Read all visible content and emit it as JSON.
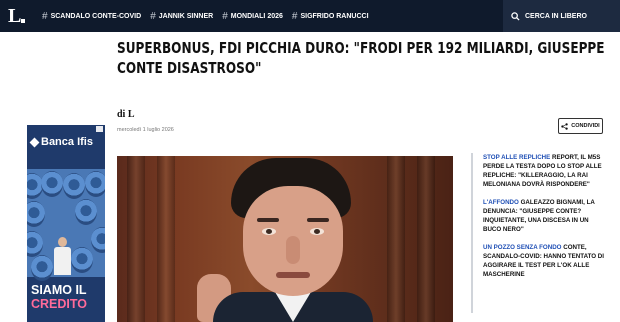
{
  "header": {
    "logo_text": "L",
    "topics": [
      {
        "label": "SCANDALO CONTE-COVID"
      },
      {
        "label": "JANNIK SINNER"
      },
      {
        "label": "MONDIALI 2026"
      },
      {
        "label": "SIGFRIDO RANUCCI"
      }
    ],
    "search_label": "CERCA IN LIBERO",
    "search_icon": "search-icon"
  },
  "article": {
    "headline": "SUPERBONUS, FDI PICCHIA DURO: \"FRODI PER 192 MILIARDI, GIUSEPPE CONTE DISASTROSO\"",
    "author_logo": "di L",
    "date": "mercoledì 1 luglio 2026",
    "share_label": "CONDIVIDI",
    "share_icon": "share-icon"
  },
  "ad": {
    "brand": "Banca Ifis",
    "text_line1": "SIAMO IL",
    "text_line2": "CREDITO"
  },
  "sidebar": {
    "items": [
      {
        "kicker": "STOP ALLE REPLICHE",
        "text": "REPORT, IL M5S PERDE LA TESTA DOPO LO STOP ALLE REPLICHE: \"KILLERAGGIO, LA RAI MELONIANA DOVRÀ RISPONDERE\""
      },
      {
        "kicker": "L'AFFONDO",
        "text": "GALEAZZO BIGNAMI, LA DENUNCIA: \"GIUSEPPE CONTE? INQUIETANTE, UNA DISCESA IN UN BUCO NERO\""
      },
      {
        "kicker": "UN POZZO SENZA FONDO",
        "text": "CONTE, SCANDALO-COVID: HANNO TENTATO DI AGGIRARE IL TEST PER L'OK ALLE MASCHERINE"
      }
    ]
  },
  "colors": {
    "topbar": "#0f1a2c",
    "search_bg": "#1d2a40",
    "kicker": "#1f4fb5",
    "ad_bg": "#1f3a6b"
  }
}
